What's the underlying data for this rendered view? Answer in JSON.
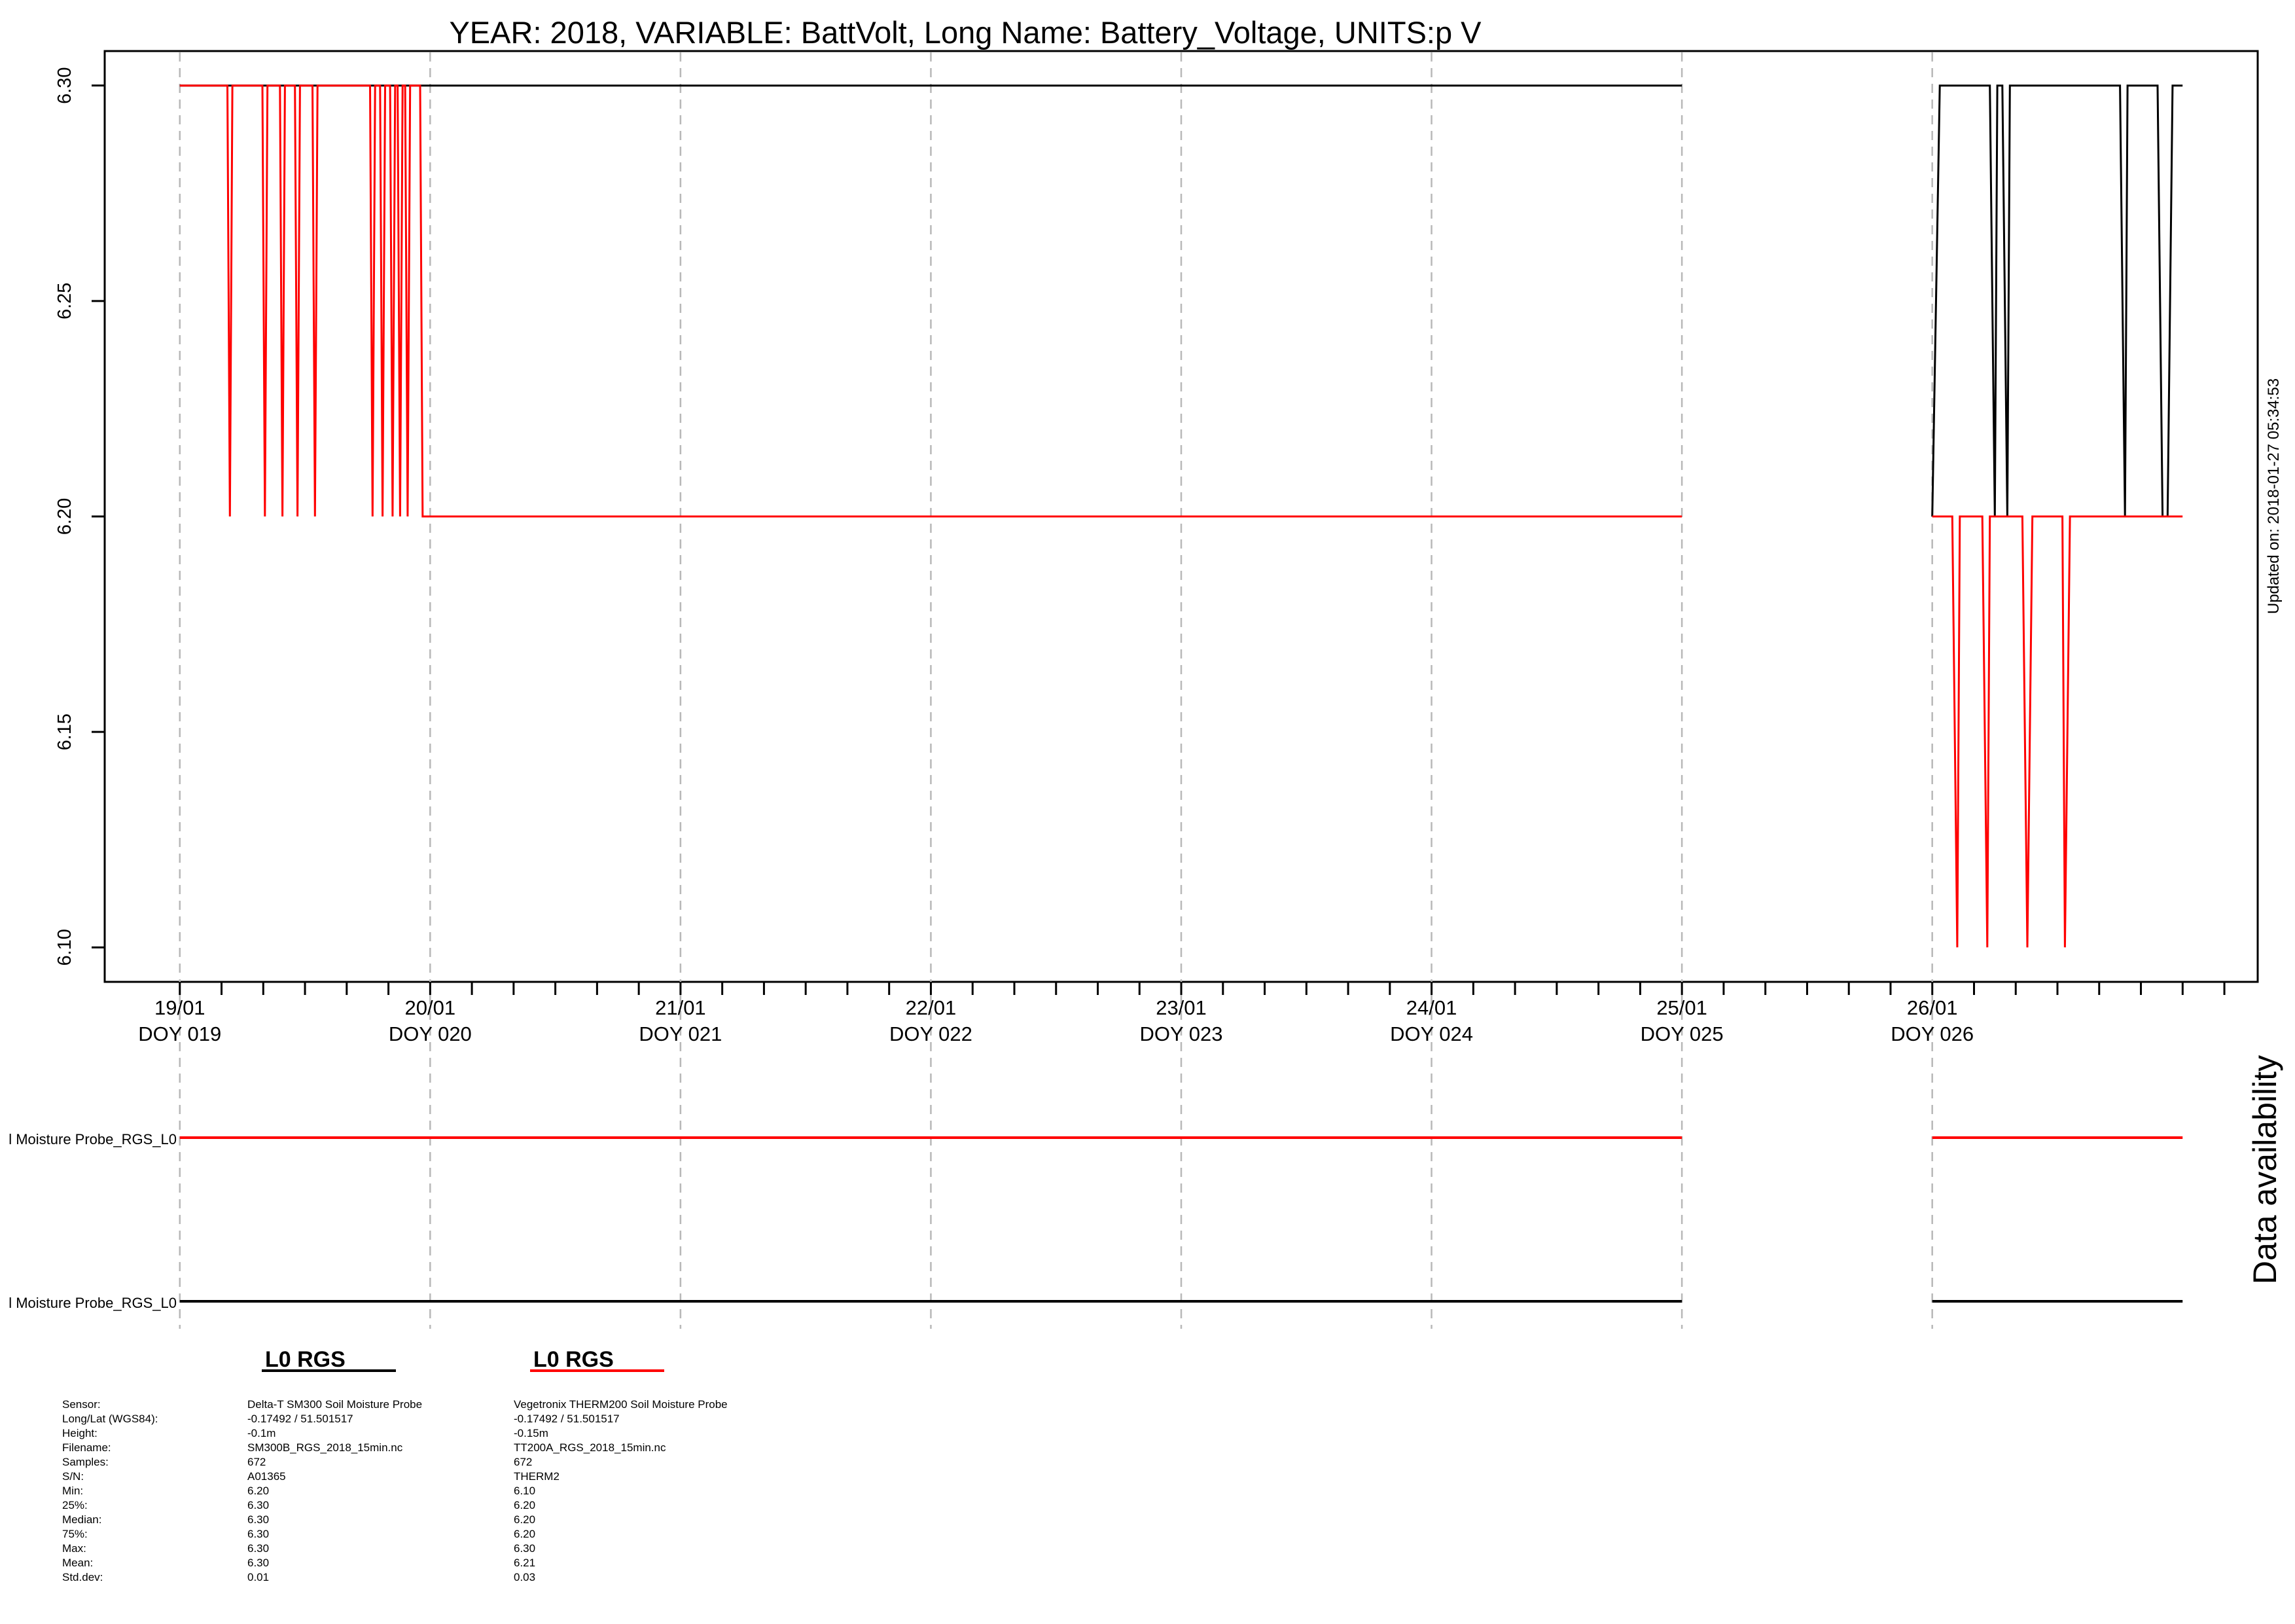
{
  "chart_data": {
    "type": "line",
    "title": "YEAR: 2018, VARIABLE: BattVolt, Long Name: Battery_Voltage, UNITS:p V",
    "updated": "Updated on: 2018-01-27 05:34:53",
    "xlim": [
      18.7,
      27.3
    ],
    "ylim": [
      6.092,
      6.308
    ],
    "yticks": [
      6.1,
      6.15,
      6.2,
      6.25,
      6.3
    ],
    "ytick_labels": [
      "6.10",
      "6.15",
      "6.20",
      "6.25",
      "6.30"
    ],
    "minor_tick_step": 0.16667,
    "day_ticks": [
      {
        "x": 19,
        "date": "19/01",
        "doy": "DOY 019"
      },
      {
        "x": 20,
        "date": "20/01",
        "doy": "DOY 020"
      },
      {
        "x": 21,
        "date": "21/01",
        "doy": "DOY 021"
      },
      {
        "x": 22,
        "date": "22/01",
        "doy": "DOY 022"
      },
      {
        "x": 23,
        "date": "23/01",
        "doy": "DOY 023"
      },
      {
        "x": 24,
        "date": "24/01",
        "doy": "DOY 024"
      },
      {
        "x": 25,
        "date": "25/01",
        "doy": "DOY 025"
      },
      {
        "x": 26,
        "date": "26/01",
        "doy": "DOY 026"
      }
    ],
    "grid": "vertical dashed at each day",
    "series": [
      {
        "name": "L0 RGS",
        "color": "#000000",
        "segments": [
          [
            [
              19.0,
              6.3
            ],
            [
              25.0,
              6.3
            ]
          ],
          [
            [
              26.0,
              6.2
            ],
            [
              26.03,
              6.3
            ],
            [
              26.23,
              6.3
            ],
            [
              26.25,
              6.2
            ],
            [
              26.26,
              6.3
            ],
            [
              26.28,
              6.3
            ],
            [
              26.3,
              6.2
            ],
            [
              26.31,
              6.3
            ],
            [
              26.75,
              6.3
            ],
            [
              26.77,
              6.2
            ],
            [
              26.78,
              6.3
            ],
            [
              26.9,
              6.3
            ],
            [
              26.92,
              6.2
            ],
            [
              26.94,
              6.2
            ],
            [
              26.96,
              6.3
            ],
            [
              27.0,
              6.3
            ]
          ]
        ]
      },
      {
        "name": "L0 RGS",
        "color": "#ff0000",
        "segments": [
          [
            [
              19.0,
              6.3
            ],
            [
              19.19,
              6.3
            ],
            [
              19.2,
              6.2
            ],
            [
              19.21,
              6.3
            ],
            [
              19.33,
              6.3
            ],
            [
              19.34,
              6.2
            ],
            [
              19.35,
              6.3
            ],
            [
              19.4,
              6.3
            ],
            [
              19.41,
              6.2
            ],
            [
              19.42,
              6.3
            ],
            [
              19.46,
              6.3
            ],
            [
              19.47,
              6.2
            ],
            [
              19.48,
              6.3
            ],
            [
              19.53,
              6.3
            ],
            [
              19.54,
              6.2
            ],
            [
              19.55,
              6.3
            ],
            [
              19.76,
              6.3
            ],
            [
              19.77,
              6.2
            ],
            [
              19.78,
              6.3
            ],
            [
              19.8,
              6.3
            ],
            [
              19.81,
              6.2
            ],
            [
              19.82,
              6.3
            ],
            [
              19.84,
              6.3
            ],
            [
              19.85,
              6.2
            ],
            [
              19.86,
              6.3
            ],
            [
              19.87,
              6.3
            ],
            [
              19.88,
              6.2
            ],
            [
              19.89,
              6.3
            ],
            [
              19.9,
              6.3
            ],
            [
              19.91,
              6.2
            ],
            [
              19.92,
              6.3
            ],
            [
              19.96,
              6.3
            ],
            [
              19.97,
              6.2
            ],
            [
              25.0,
              6.2
            ]
          ],
          [
            [
              26.0,
              6.2
            ],
            [
              26.08,
              6.2
            ],
            [
              26.1,
              6.1
            ],
            [
              26.11,
              6.2
            ],
            [
              26.2,
              6.2
            ],
            [
              26.22,
              6.1
            ],
            [
              26.23,
              6.2
            ],
            [
              26.36,
              6.2
            ],
            [
              26.38,
              6.1
            ],
            [
              26.4,
              6.2
            ],
            [
              26.52,
              6.2
            ],
            [
              26.53,
              6.1
            ],
            [
              26.55,
              6.2
            ],
            [
              27.0,
              6.2
            ]
          ]
        ]
      }
    ],
    "availability": {
      "ylabel": "Data availability",
      "rows": [
        {
          "label": "l Moisture Probe_RGS_L0",
          "color": "#ff0000",
          "ranges": [
            [
              19.0,
              25.0
            ],
            [
              26.0,
              27.0
            ]
          ]
        },
        {
          "label": "l Moisture Probe_RGS_L0",
          "color": "#000000",
          "ranges": [
            [
              19.0,
              25.0
            ],
            [
              26.0,
              27.0
            ]
          ]
        }
      ]
    }
  },
  "legend": {
    "labels": [
      "Sensor:",
      "Long/Lat (WGS84):",
      "Height:",
      "Filename:",
      "Samples:",
      "S/N:",
      "Min:",
      "25%:",
      "Median:",
      "75%:",
      "Max:",
      "Mean:",
      "Std.dev:"
    ],
    "columns": [
      {
        "title": "L0 RGS",
        "color": "#000000",
        "values": [
          "Delta-T SM300 Soil Moisture Probe",
          " -0.17492 / 51.501517",
          " -0.1m",
          "SM300B_RGS_2018_15min.nc",
          "672",
          "A01365",
          "6.20",
          "6.30",
          "6.30",
          "6.30",
          "6.30",
          "6.30",
          "0.01"
        ]
      },
      {
        "title": "L0 RGS",
        "color": "#ff0000",
        "values": [
          "Vegetronix THERM200 Soil Moisture Probe",
          " -0.17492 / 51.501517",
          " -0.15m",
          "TT200A_RGS_2018_15min.nc",
          "672",
          "THERM2",
          "6.10",
          "6.20",
          "6.20",
          "6.20",
          "6.30",
          "6.21",
          "0.03"
        ]
      }
    ]
  }
}
